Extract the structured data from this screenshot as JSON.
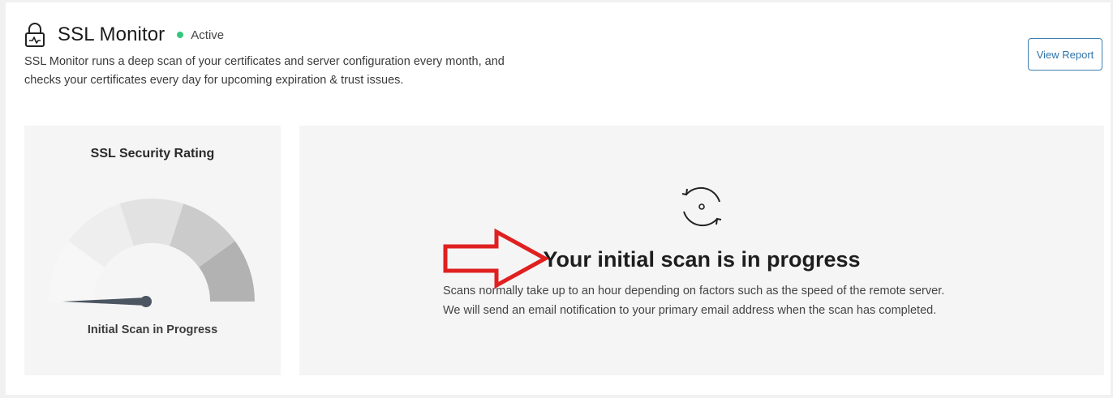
{
  "header": {
    "title": "SSL Monitor",
    "status_text": "Active",
    "status_color": "#34c77b",
    "icon": "lock-icon",
    "description": "SSL Monitor runs a deep scan of your certificates and server configuration every month, and checks your certificates every day for upcoming expiration & trust issues.",
    "view_report_label": "View Report"
  },
  "rating": {
    "title": "SSL Security Rating",
    "status_label": "Initial Scan in Progress",
    "gauge_level": 0,
    "gauge_segment_colors": [
      "#f7f7f7",
      "#eeeeee",
      "#e2e2e2",
      "#cbcbcb",
      "#b2b2b2"
    ],
    "needle_color": "#4c5562"
  },
  "scan": {
    "icon": "refresh-icon",
    "heading": "Your initial scan is in progress",
    "line1": "Scans normally take up to an hour depending on factors such as the speed of the remote server.",
    "line2": "We will send an email notification to your primary email address when the scan has completed."
  },
  "annotation": {
    "arrow_color": "#e02020"
  }
}
